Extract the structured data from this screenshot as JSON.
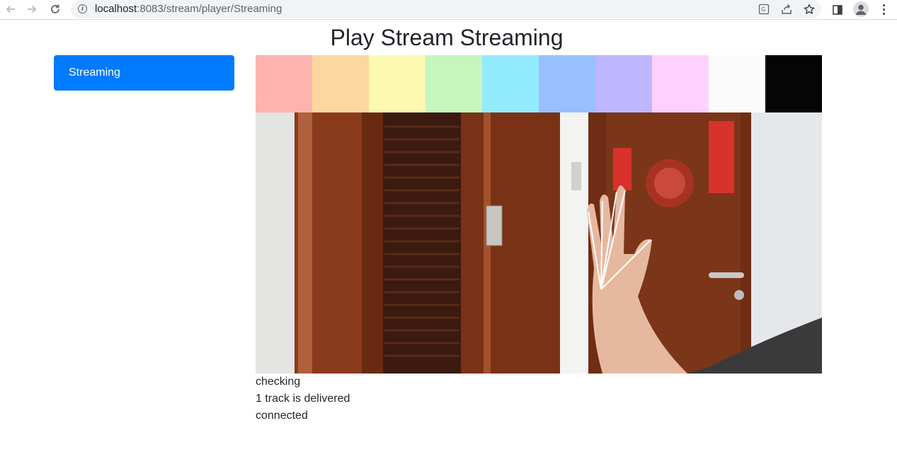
{
  "browser": {
    "url_host": "localhost",
    "url_path": ":8083/stream/player/Streaming"
  },
  "page": {
    "title": "Play Stream Streaming"
  },
  "sidebar": {
    "items": [
      {
        "label": "Streaming",
        "active": true
      }
    ]
  },
  "video": {
    "color_bars": [
      "#ffb3ae",
      "#fdd7a0",
      "#fcf9b0",
      "#c6f5be",
      "#93ebfe",
      "#98c0fe",
      "#beb6fe",
      "#fdd1fe",
      "#fafbfa",
      "#050505"
    ]
  },
  "status": {
    "lines": [
      "checking",
      "1 track is delivered",
      "connected"
    ]
  },
  "colors": {
    "primary": "#007bff"
  }
}
